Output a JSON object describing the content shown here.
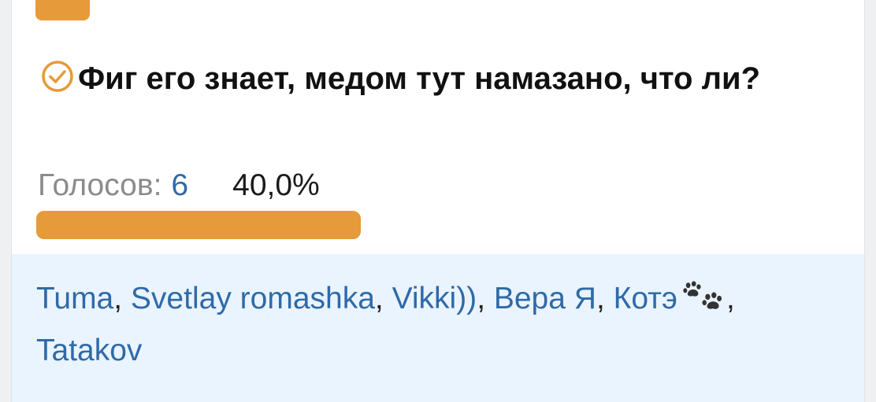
{
  "colors": {
    "accent": "#e69a3a",
    "link": "#2f6aa8",
    "voters_bg": "#eaf4fe"
  },
  "option": {
    "title": "Фиг его знает, медом тут намазано, что ли?",
    "icon": "check-circle-icon",
    "votes_label": "Голосов:",
    "votes_count": "6",
    "percent_text": "40,0%",
    "progress_fraction": 0.4
  },
  "voters": [
    {
      "name": "Tuma",
      "icon": null
    },
    {
      "name": "Svetlay romashka",
      "icon": null
    },
    {
      "name": "Vikki))",
      "icon": null
    },
    {
      "name": "Вера Я",
      "icon": null
    },
    {
      "name": "Котэ",
      "icon": "paw-prints-icon"
    },
    {
      "name": "Tatakov",
      "icon": null
    }
  ],
  "separator": ", "
}
